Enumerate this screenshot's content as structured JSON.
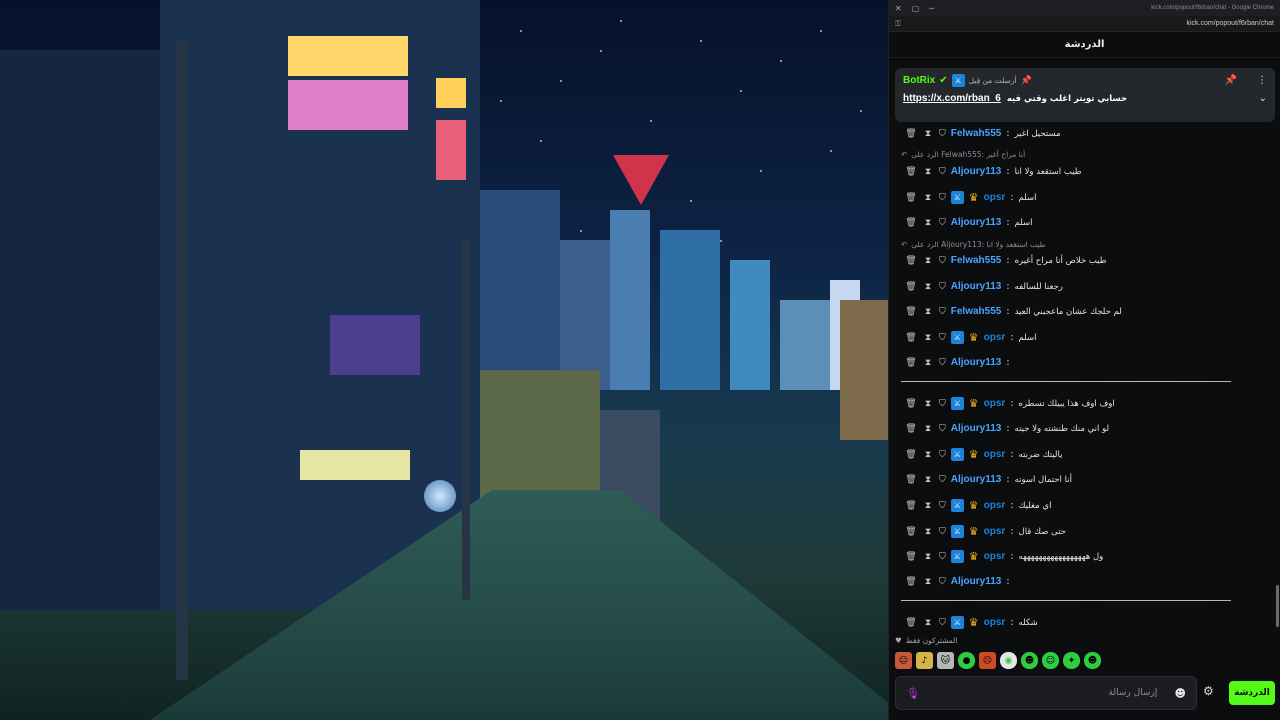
{
  "window": {
    "title": "kick.com/popout/f6rban/chat - Google Chrome",
    "url": "kick.com/popout/f6rban/chat"
  },
  "chat": {
    "title": "الدردشة",
    "pinned": {
      "label": "أرسلت من قِبل",
      "user": "BotRix",
      "text": "حسابي تويتر اغلب وقتي فيه",
      "link": "https://x.com/rban_6"
    },
    "colors": {
      "opsr": "#1e82d8",
      "default": "#4aa3ff",
      "accent": "#53fc18"
    },
    "messages": [
      {
        "user": "Felwah555",
        "text": "مستحيل اغير",
        "badges": [
          "shield"
        ]
      },
      {
        "reply": "الرد على Felwah555: أنا مراح أغير"
      },
      {
        "user": "Aljoury113",
        "text": "طيب استقعد ولا انا",
        "badges": [
          "shield"
        ]
      },
      {
        "user": "opsr",
        "text": "اسلم",
        "badges": [
          "shield",
          "box",
          "crown"
        ]
      },
      {
        "user": "Aljoury113",
        "text": "اسلم",
        "badges": [
          "shield"
        ]
      },
      {
        "reply": "الرد على Aljoury113: طيب استقعد ولا انا"
      },
      {
        "user": "Felwah555",
        "text": "طيب خلاص أنا مراح أغيره",
        "badges": [
          "shield"
        ]
      },
      {
        "user": "Aljoury113",
        "text": "رجعنا للسالفه",
        "badges": [
          "shield"
        ]
      },
      {
        "user": "Felwah555",
        "text": "لم حلجك عشان ماعجبني العيد",
        "badges": [
          "shield"
        ]
      },
      {
        "user": "opsr",
        "text": "اسلم",
        "badges": [
          "shield",
          "box",
          "crown"
        ]
      },
      {
        "user": "Aljoury113",
        "text": "",
        "badges": [
          "shield"
        ]
      },
      {
        "long": "ـــــــــــــــــــــــــــــــــــــــــــــــــــــــــــــــــــــــــــــــــــــــــــــــــــــــــــــــــــــــــــــــــــــــــــــــــــــــــ"
      },
      {
        "user": "opsr",
        "text": "اوف اوف هذا يبيلك تسطره",
        "badges": [
          "shield",
          "box",
          "crown"
        ]
      },
      {
        "user": "Aljoury113",
        "text": "لو اني منك طنشته ولا جيته",
        "badges": [
          "shield"
        ]
      },
      {
        "user": "opsr",
        "text": "ياليتك ضربته",
        "badges": [
          "shield",
          "box",
          "crown"
        ]
      },
      {
        "user": "Aljoury113",
        "text": "أنا احتمال اسوته",
        "badges": [
          "shield"
        ]
      },
      {
        "user": "opsr",
        "text": "اي مغليك",
        "badges": [
          "shield",
          "box",
          "crown"
        ]
      },
      {
        "user": "opsr",
        "text": "حتى صك قال",
        "badges": [
          "shield",
          "box",
          "crown"
        ]
      },
      {
        "user": "opsr",
        "text": "ول هههههههههههههههههه",
        "badges": [
          "shield",
          "box",
          "crown"
        ]
      },
      {
        "user": "Aljoury113",
        "text": "",
        "badges": [
          "shield"
        ]
      },
      {
        "long": "ـــــــــــــــــــــــــــــــــــــــــــــــــــــــــــــــــــــــــــــــــــــــــــــــــــــــــــــــــــــــــــــــــــــــــــــــــــــــــ"
      },
      {
        "user": "opsr",
        "text": "شكله",
        "badges": [
          "shield",
          "box",
          "crown"
        ]
      }
    ],
    "footer": {
      "subs_label": "المشتركون فقط",
      "placeholder": "إرسال رسالة",
      "send_label": "الدردشة"
    }
  }
}
